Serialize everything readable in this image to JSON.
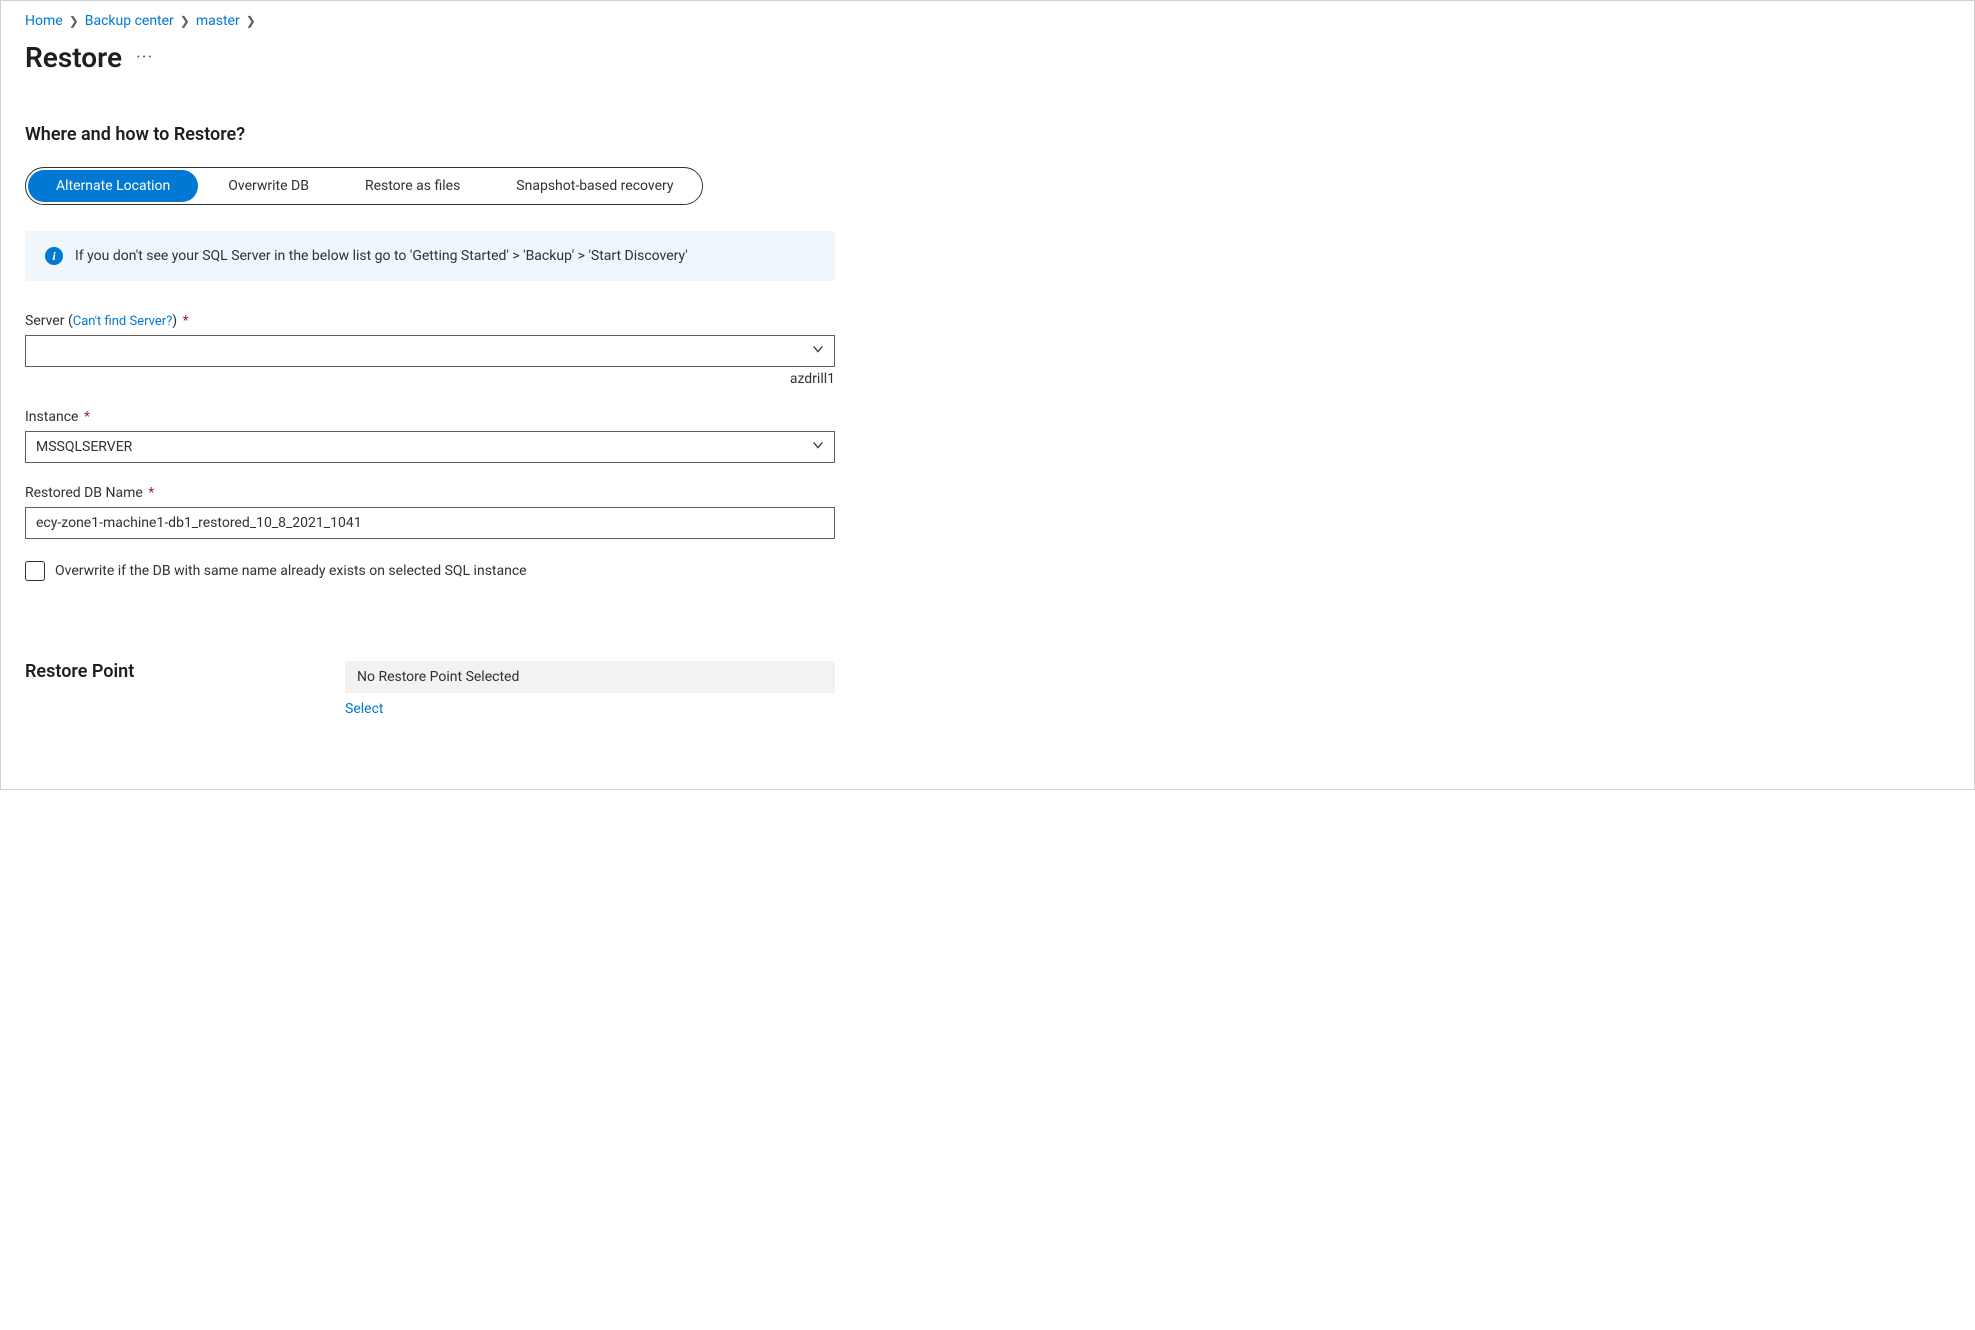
{
  "breadcrumb": {
    "home": "Home",
    "backup_center": "Backup center",
    "master": "master"
  },
  "page": {
    "title": "Restore",
    "section_heading": "Where and how to Restore?"
  },
  "tabs": {
    "alternate_location": "Alternate Location",
    "overwrite_db": "Overwrite DB",
    "restore_as_files": "Restore as files",
    "snapshot_recovery": "Snapshot-based recovery"
  },
  "info": {
    "text": "If you don't see your SQL Server in the below list go to 'Getting Started' > 'Backup' > 'Start Discovery'"
  },
  "fields": {
    "server": {
      "label": "Server",
      "help_link": "Can't find Server?",
      "value": "",
      "helper": "azdrill1"
    },
    "instance": {
      "label": "Instance",
      "value": "MSSQLSERVER"
    },
    "restored_db_name": {
      "label": "Restored DB Name",
      "value": "ecy-zone1-machine1-db1_restored_10_8_2021_1041"
    },
    "overwrite_checkbox": {
      "label": "Overwrite if the DB with same name already exists on selected SQL instance"
    }
  },
  "restore_point": {
    "label": "Restore Point",
    "status": "No Restore Point Selected",
    "select_link": "Select"
  }
}
